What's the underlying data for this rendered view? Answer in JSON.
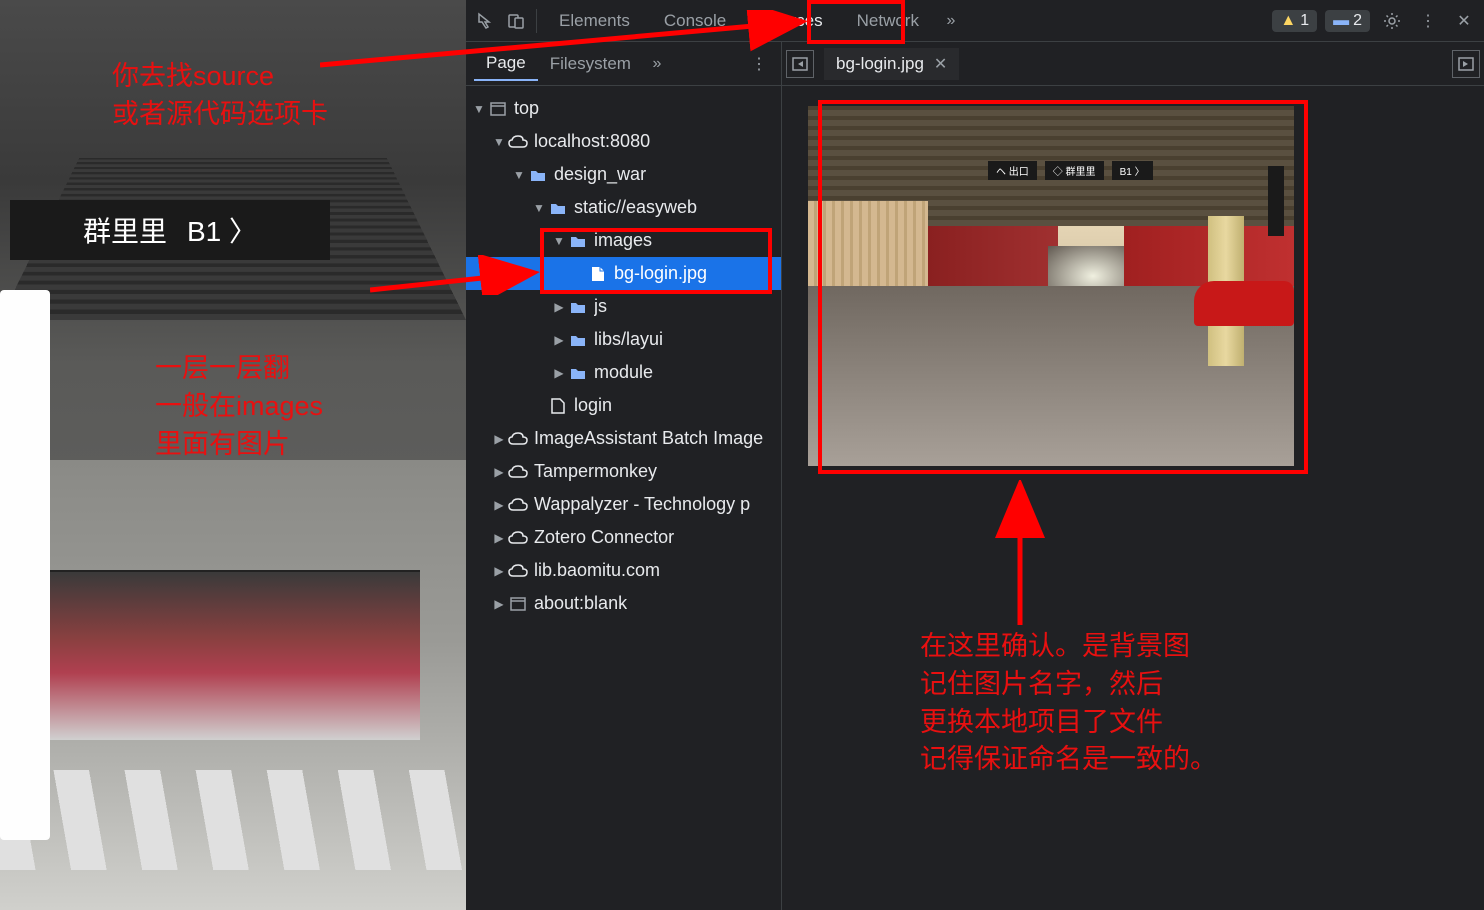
{
  "bg_sign": {
    "text1": "群里里",
    "text2": "B1 〉"
  },
  "toolbar": {
    "tabs": [
      "Elements",
      "Console",
      "Sources",
      "Network"
    ],
    "active_tab": "Sources",
    "warn_count": "1",
    "info_count": "2"
  },
  "nav_tabs": {
    "page": "Page",
    "filesystem": "Filesystem"
  },
  "tree": {
    "top": "top",
    "host": "localhost:8080",
    "design": "design_war",
    "static": "static//easyweb",
    "images": "images",
    "bglogin": "bg-login.jpg",
    "js": "js",
    "libs": "libs/layui",
    "module": "module",
    "login": "login",
    "imgassist": "ImageAssistant Batch Image",
    "tamper": "Tampermonkey",
    "wappa": "Wappalyzer - Technology p",
    "zotero": "Zotero Connector",
    "baomitu": "lib.baomitu.com",
    "blank": "about:blank"
  },
  "file_tab": "bg-login.jpg",
  "preview_sign": {
    "a": "ヘ 出口",
    "b": "◇ 群里里",
    "c": "B1 〉"
  },
  "anno": {
    "top": "你去找source\n或者源代码选项卡",
    "mid": "一层一层翻\n一般在images\n里面有图片",
    "right": "在这里确认。是背景图\n记住图片名字，然后\n更换本地项目了文件\n记得保证命名是一致的。"
  }
}
